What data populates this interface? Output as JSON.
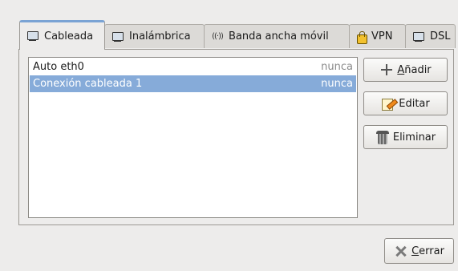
{
  "tabs": [
    {
      "label": "Cableada",
      "icon": "wired-network-icon",
      "active": true
    },
    {
      "label": "Inalámbrica",
      "icon": "wireless-network-icon",
      "active": false
    },
    {
      "label": "Banda ancha móvil",
      "icon": "antenna-icon",
      "active": false
    },
    {
      "label": "VPN",
      "icon": "vpn-lock-icon",
      "active": false
    },
    {
      "label": "DSL",
      "icon": "dsl-network-icon",
      "active": false
    }
  ],
  "connections": [
    {
      "name": "Auto eth0",
      "last_used": "nunca",
      "selected": false
    },
    {
      "name": "Conexión cableada 1",
      "last_used": "nunca",
      "selected": true
    }
  ],
  "buttons": {
    "add_mnemonic": "A",
    "add_rest": "ñadir",
    "edit": "Editar",
    "delete": "Eliminar",
    "close_mnemonic": "C",
    "close_rest": "errar"
  },
  "antenna_glyph": "((·))",
  "colors": {
    "selection": "#86abd9",
    "active_tab_highlight": "#7aa3d4",
    "window_background": "#edeceb"
  }
}
